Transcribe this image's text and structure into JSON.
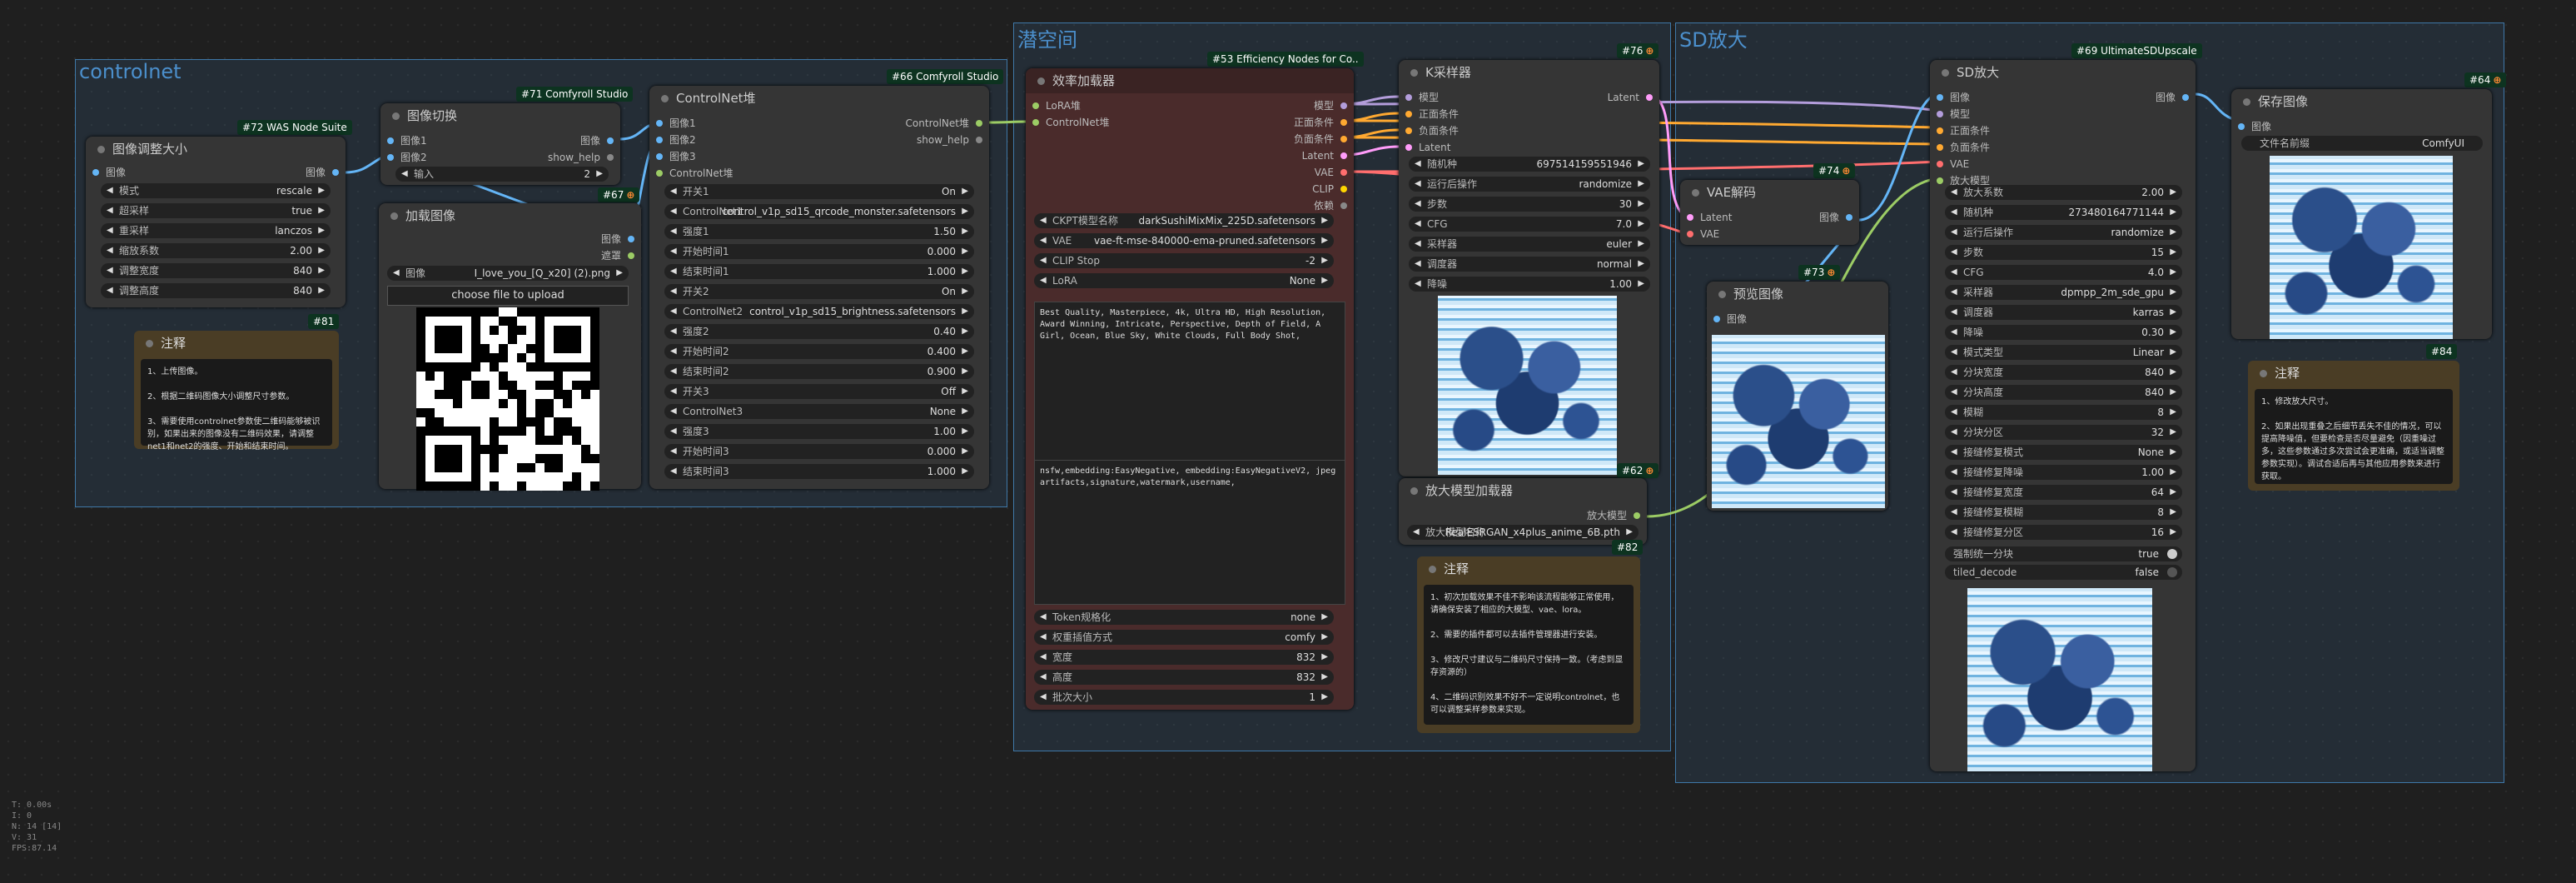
{
  "groups": {
    "controlnet": "controlnet",
    "latent": "潜空间",
    "sd": "SD放大"
  },
  "badges": {
    "b72": "#72 WAS Node Suite",
    "b71": "#71 Comfyroll Studio",
    "b66": "#66 Comfyroll Studio",
    "b67": "#67",
    "b81": "#81",
    "b53": "#53 Efficiency Nodes for Co..",
    "b76": "#76",
    "b74": "#74",
    "b73": "#73",
    "b62": "#62",
    "b82": "#82",
    "b69": "#69 UltimateSDUpscale",
    "b64": "#64",
    "b84": "#84"
  },
  "resize": {
    "title": "图像调整大小",
    "in": "图像",
    "out": "图像",
    "w": [
      [
        "模式",
        "rescale"
      ],
      [
        "超采样",
        "true"
      ],
      [
        "重采样",
        "lanczos"
      ],
      [
        "缩放系数",
        "2.00"
      ],
      [
        "调整宽度",
        "840"
      ],
      [
        "调整高度",
        "840"
      ]
    ]
  },
  "imgswitch": {
    "title": "图像切换",
    "in1": "图像1",
    "in2": "图像2",
    "out1": "图像",
    "out2": "show_help",
    "w_label": "输入",
    "w_val": "2"
  },
  "cnstack": {
    "title": "ControlNet堆",
    "in": [
      "图像1",
      "图像2",
      "图像3",
      "ControlNet堆"
    ],
    "out1": "ControlNet堆",
    "out2": "show_help",
    "w": [
      [
        "开关1",
        "On"
      ],
      [
        "ControlNet1",
        "control_v1p_sd15_qrcode_monster.safetensors"
      ],
      [
        "强度1",
        "1.50"
      ],
      [
        "开始时间1",
        "0.000"
      ],
      [
        "结束时间1",
        "1.000"
      ],
      [
        "开关2",
        "On"
      ],
      [
        "ControlNet2",
        "control_v1p_sd15_brightness.safetensors"
      ],
      [
        "强度2",
        "0.40"
      ],
      [
        "开始时间2",
        "0.400"
      ],
      [
        "结束时间2",
        "0.900"
      ],
      [
        "开关3",
        "Off"
      ],
      [
        "ControlNet3",
        "None"
      ],
      [
        "强度3",
        "1.00"
      ],
      [
        "开始时间3",
        "0.000"
      ],
      [
        "结束时间3",
        "1.000"
      ]
    ]
  },
  "loadimg": {
    "title": "加载图像",
    "out1": "图像",
    "out2": "遮罩",
    "w_label": "图像",
    "w_val": "I_love_you_[Q_x20] (2).png",
    "button": "choose file to upload"
  },
  "note81": {
    "title": "注释",
    "text": "1、上传图像。\n\n2、根据二维码图像大小调整尺寸参数。\n\n3、需要使用controlnet参数使二维码能够被识别，如果出来的图像没有二维码效果，请调整net1和net2的强度、开始和结束时间。"
  },
  "loader": {
    "title": "效率加载器",
    "in1": "LoRA堆",
    "in2": "ControlNet堆",
    "outs": [
      "模型",
      "正面条件",
      "负面条件",
      "Latent",
      "VAE",
      "CLIP",
      "依赖"
    ],
    "w_top": [
      [
        "CKPT模型名称",
        "darkSushiMixMix_225D.safetensors"
      ],
      [
        "VAE",
        "vae-ft-mse-840000-ema-pruned.safetensors"
      ],
      [
        "CLIP Stop",
        "-2"
      ],
      [
        "LoRA",
        "None"
      ]
    ],
    "pos": "Best Quality, Masterpiece, 4k, Ultra HD, High Resolution, Award Winning, Intricate, Perspective, Depth of Field, A Girl, Ocean, Blue Sky, White Clouds, Full Body Shot,",
    "neg": "nsfw,embedding:EasyNegative, embedding:EasyNegativeV2, jpeg artifacts,signature,watermark,username,",
    "w_bot": [
      [
        "Token规格化",
        "none"
      ],
      [
        "权重插值方式",
        "comfy"
      ],
      [
        "宽度",
        "832"
      ],
      [
        "高度",
        "832"
      ],
      [
        "批次大小",
        "1"
      ]
    ]
  },
  "ksampler": {
    "title": "K采样器",
    "ins": [
      "模型",
      "正面条件",
      "负面条件",
      "Latent"
    ],
    "out": "Latent",
    "w": [
      [
        "随机种",
        "697514159551946"
      ],
      [
        "运行后操作",
        "randomize"
      ],
      [
        "步数",
        "30"
      ],
      [
        "CFG",
        "7.0"
      ],
      [
        "采样器",
        "euler"
      ],
      [
        "调度器",
        "normal"
      ],
      [
        "降噪",
        "1.00"
      ]
    ]
  },
  "vaedec": {
    "title": "VAE解码",
    "in1": "Latent",
    "in2": "VAE",
    "out": "图像"
  },
  "preview": {
    "title": "预览图像",
    "in": "图像"
  },
  "upload": {
    "title": "放大模型加载器",
    "out": "放大模型",
    "w_label": "放大模型名称",
    "w_val": "RealESRGAN_x4plus_anime_6B.pth"
  },
  "note82": {
    "title": "注释",
    "text": "1、初次加载效果不佳不影响该流程能够正常使用，请确保安装了相应的大模型、vae、lora。\n\n2、需要的插件都可以去插件管理器进行安装。\n\n3、修改尺寸建议与二维码尺寸保持一致。（考虑到显存资源的）\n\n4、二维码识别效果不好不一定说明controlnet，也可以调整采样参数来实现。"
  },
  "sdup": {
    "title": "SD放大",
    "ins": [
      "图像",
      "模型",
      "正面条件",
      "负面条件",
      "VAE",
      "放大模型"
    ],
    "out": "图像",
    "w": [
      [
        "放大系数",
        "2.00"
      ],
      [
        "随机种",
        "273480164771144"
      ],
      [
        "运行后操作",
        "randomize"
      ],
      [
        "步数",
        "15"
      ],
      [
        "CFG",
        "4.0"
      ],
      [
        "采样器",
        "dpmpp_2m_sde_gpu"
      ],
      [
        "调度器",
        "karras"
      ],
      [
        "降噪",
        "0.30"
      ],
      [
        "模式类型",
        "Linear"
      ],
      [
        "分块宽度",
        "840"
      ],
      [
        "分块高度",
        "840"
      ],
      [
        "模糊",
        "8"
      ],
      [
        "分块分区",
        "32"
      ],
      [
        "接缝修复模式",
        "None"
      ],
      [
        "接缝修复降噪",
        "1.00"
      ],
      [
        "接缝修复宽度",
        "64"
      ],
      [
        "接缝修复模糊",
        "8"
      ],
      [
        "接缝修复分区",
        "16"
      ]
    ],
    "toggle1": [
      "强制统一分块",
      "true"
    ],
    "toggle2": [
      "tiled_decode",
      "false"
    ]
  },
  "save": {
    "title": "保存图像",
    "in": "图像",
    "w_label": "文件名前缀",
    "w_val": "ComfyUI"
  },
  "note84": {
    "title": "注释",
    "text": "1、修改放大尺寸。\n\n2、如果出现重叠之后细节丢失不佳的情况，可以提高降噪值，但要检查是否尽量避免（因重噪过多，这些参数通过多次尝试会更准确，或适当调整参数实现）。调试合适后再与其他应用参数来进行获取。"
  },
  "stats": [
    "T: 0.00s",
    "I: 0",
    "N: 14 [14]",
    "V: 31",
    "FPS:87.14"
  ],
  "colors": {
    "accent": "#3f78a8",
    "badge": "#0d3320",
    "model": "#b39ddb",
    "cond": "#ffa931",
    "latent": "#ff9cf9",
    "vae": "#ff6e6e",
    "image": "#64b5f6",
    "clip": "#ffd500"
  }
}
